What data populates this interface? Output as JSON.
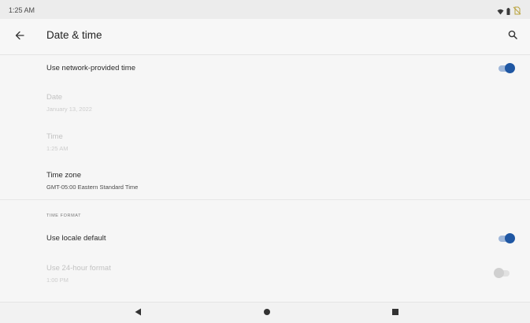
{
  "status_bar": {
    "time": "1:25 AM",
    "icons": [
      "wifi-icon",
      "battery-icon",
      "no-sim-icon"
    ]
  },
  "app_bar": {
    "title": "Date & time",
    "back_icon": "arrow-back-icon",
    "search_icon": "search-icon"
  },
  "settings": {
    "network_time": {
      "title": "Use network-provided time",
      "enabled": true
    },
    "date": {
      "title": "Date",
      "value": "January 13, 2022"
    },
    "time": {
      "title": "Time",
      "value": "1:25 AM"
    },
    "time_zone": {
      "title": "Time zone",
      "value": "GMT-05:00 Eastern Standard Time"
    }
  },
  "time_format": {
    "header": "TIME FORMAT",
    "locale_default": {
      "title": "Use locale default",
      "enabled": true
    },
    "use_24_hour": {
      "title": "Use 24-hour format",
      "value": "1:00 PM",
      "enabled": false
    }
  },
  "nav_bar": {
    "icons": [
      "back-triangle-icon",
      "home-circle-icon",
      "recents-square-icon"
    ]
  },
  "colors": {
    "accent": "#1f57a3",
    "accent_track": "#9fb7d9",
    "background": "#f6f6f6"
  }
}
